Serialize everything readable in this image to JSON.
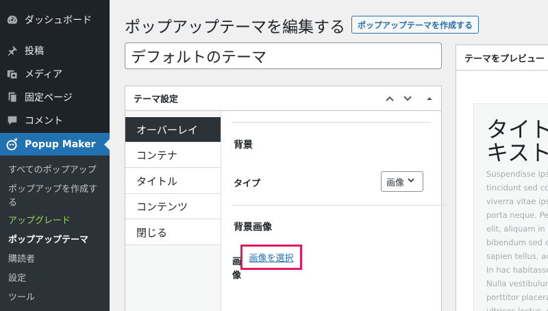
{
  "sidebar": {
    "menu": [
      {
        "label": "ダッシュボード",
        "icon": "dashboard-icon"
      },
      {
        "label": "投稿",
        "icon": "pin-icon"
      },
      {
        "label": "メディア",
        "icon": "media-icon"
      },
      {
        "label": "固定ページ",
        "icon": "page-icon"
      },
      {
        "label": "コメント",
        "icon": "comment-icon"
      },
      {
        "label": "Popup Maker",
        "icon": "popup-maker-icon"
      }
    ],
    "submenu": [
      "すべてのポップアップ",
      "ポップアップを作成する",
      "アップグレード",
      "ポップアップテーマ",
      "購読者",
      "設定",
      "ツール"
    ]
  },
  "header": {
    "title": "ポップアップテーマを編集する",
    "add_new_label": "ポップアップテーマを作成する"
  },
  "title_input": {
    "value": "デフォルトのテーマ"
  },
  "settings_box": {
    "title": "テーマ設定",
    "tabs": [
      "オーバーレイ",
      "コンテナ",
      "タイトル",
      "コンテンツ",
      "閉じる"
    ],
    "background_heading": "背景",
    "type_label": "タイプ",
    "type_value": "画像",
    "background_image_heading": "背景画像",
    "image_label": "画像",
    "select_image_label": "画像を選択"
  },
  "preview": {
    "header": "テーマをプレビュー",
    "title": "タイトルテ\nキスト",
    "text_lines": [
      "Suspendisse ipsum",
      "tincidunt sed co",
      "viverra vitae ips",
      "porta neque. Pe",
      "elit, aliquam in u",
      "bibendum sed co",
      "sapien tellus, ac",
      "In hac habitasse",
      "Nulla vestibulum",
      "porttitor placera",
      "ultrices lectus, e"
    ]
  },
  "colors": {
    "sidebar_bg": "#1d2327",
    "accent": "#2271b1",
    "upgrade": "#9bd55a",
    "highlight": "#e2195b"
  }
}
